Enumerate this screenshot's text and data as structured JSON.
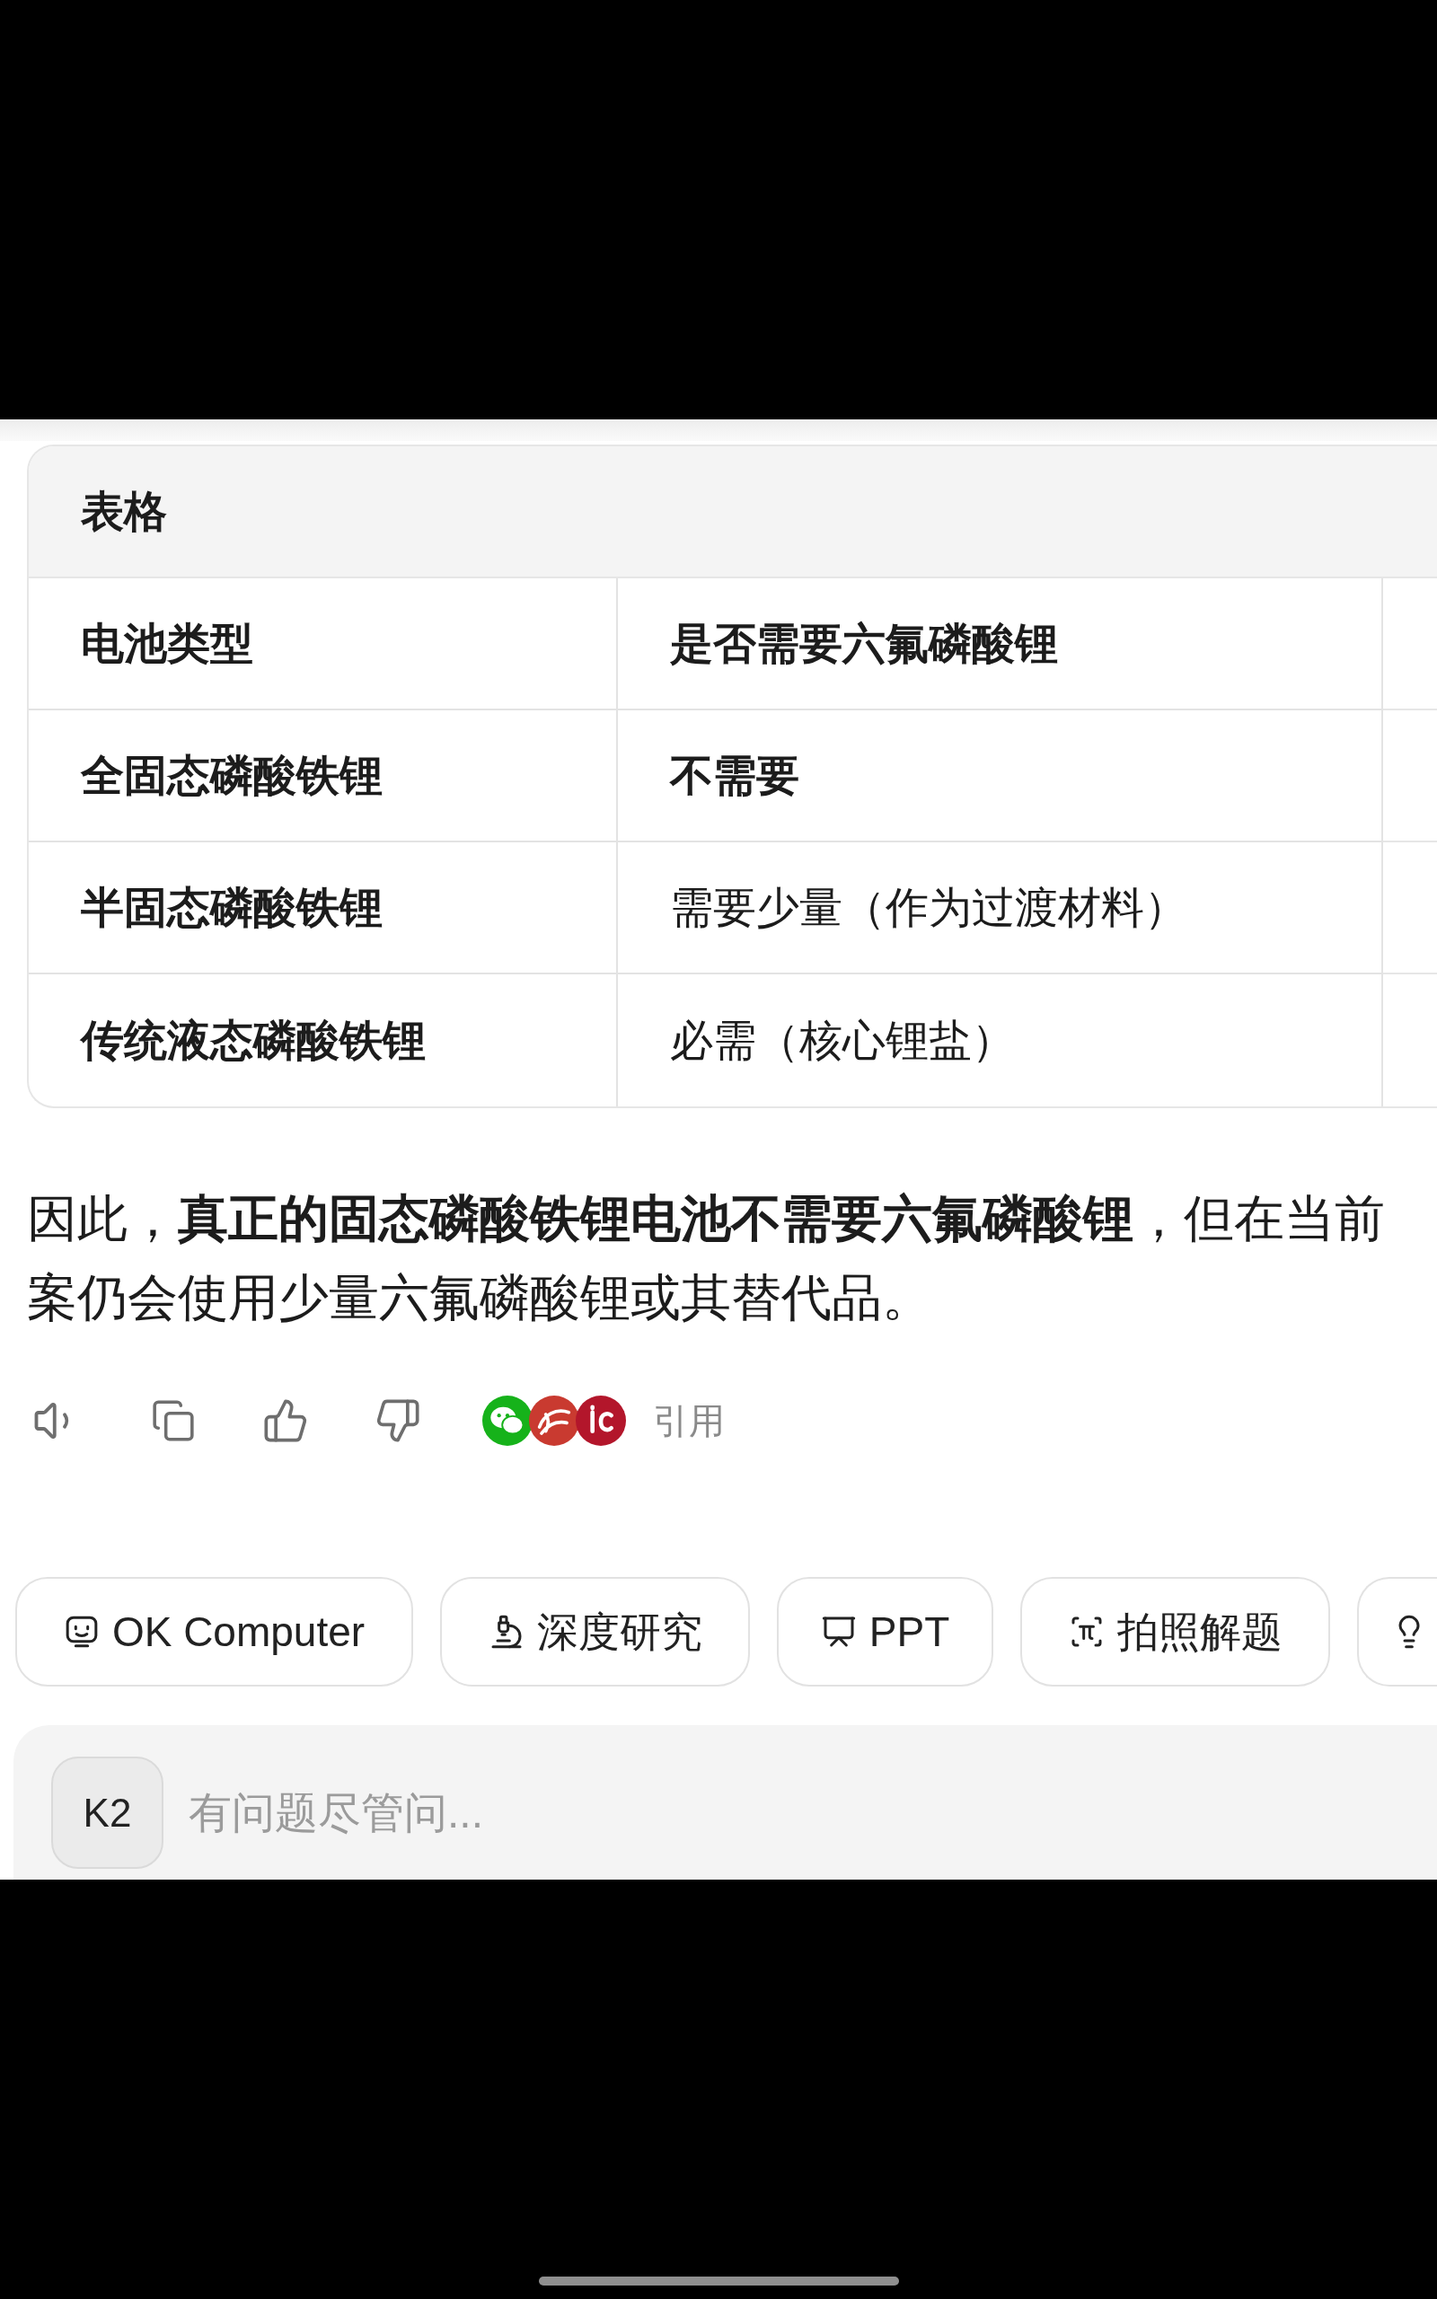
{
  "table": {
    "title": "表格",
    "columns": [
      "电池类型",
      "是否需要六氟磷酸锂"
    ],
    "rows": [
      [
        {
          "text": "全固态磷酸铁锂",
          "bold": true
        },
        {
          "text": "不需要",
          "bold": true
        }
      ],
      [
        {
          "text": "半固态磷酸铁锂",
          "bold": true
        },
        {
          "text": "需要少量（作为过渡材料）",
          "bold": false
        }
      ],
      [
        {
          "text": "传统液态磷酸铁锂",
          "bold": true
        },
        {
          "text": "必需（核心锂盐）",
          "bold": false
        }
      ]
    ]
  },
  "answer": {
    "lines": [
      "因此，**真正的固态磷酸铁锂电池不需要六氟磷酸锂**，但在当前",
      "案仍会使用少量六氟磷酸锂或其替代品。"
    ]
  },
  "citations": {
    "label": "引用"
  },
  "shortcuts": [
    {
      "label": "OK Computer"
    },
    {
      "label": "深度研究"
    },
    {
      "label": "PPT"
    },
    {
      "label": "拍照解题"
    }
  ],
  "composer": {
    "model": "K2",
    "placeholder": "有问题尽管问..."
  }
}
